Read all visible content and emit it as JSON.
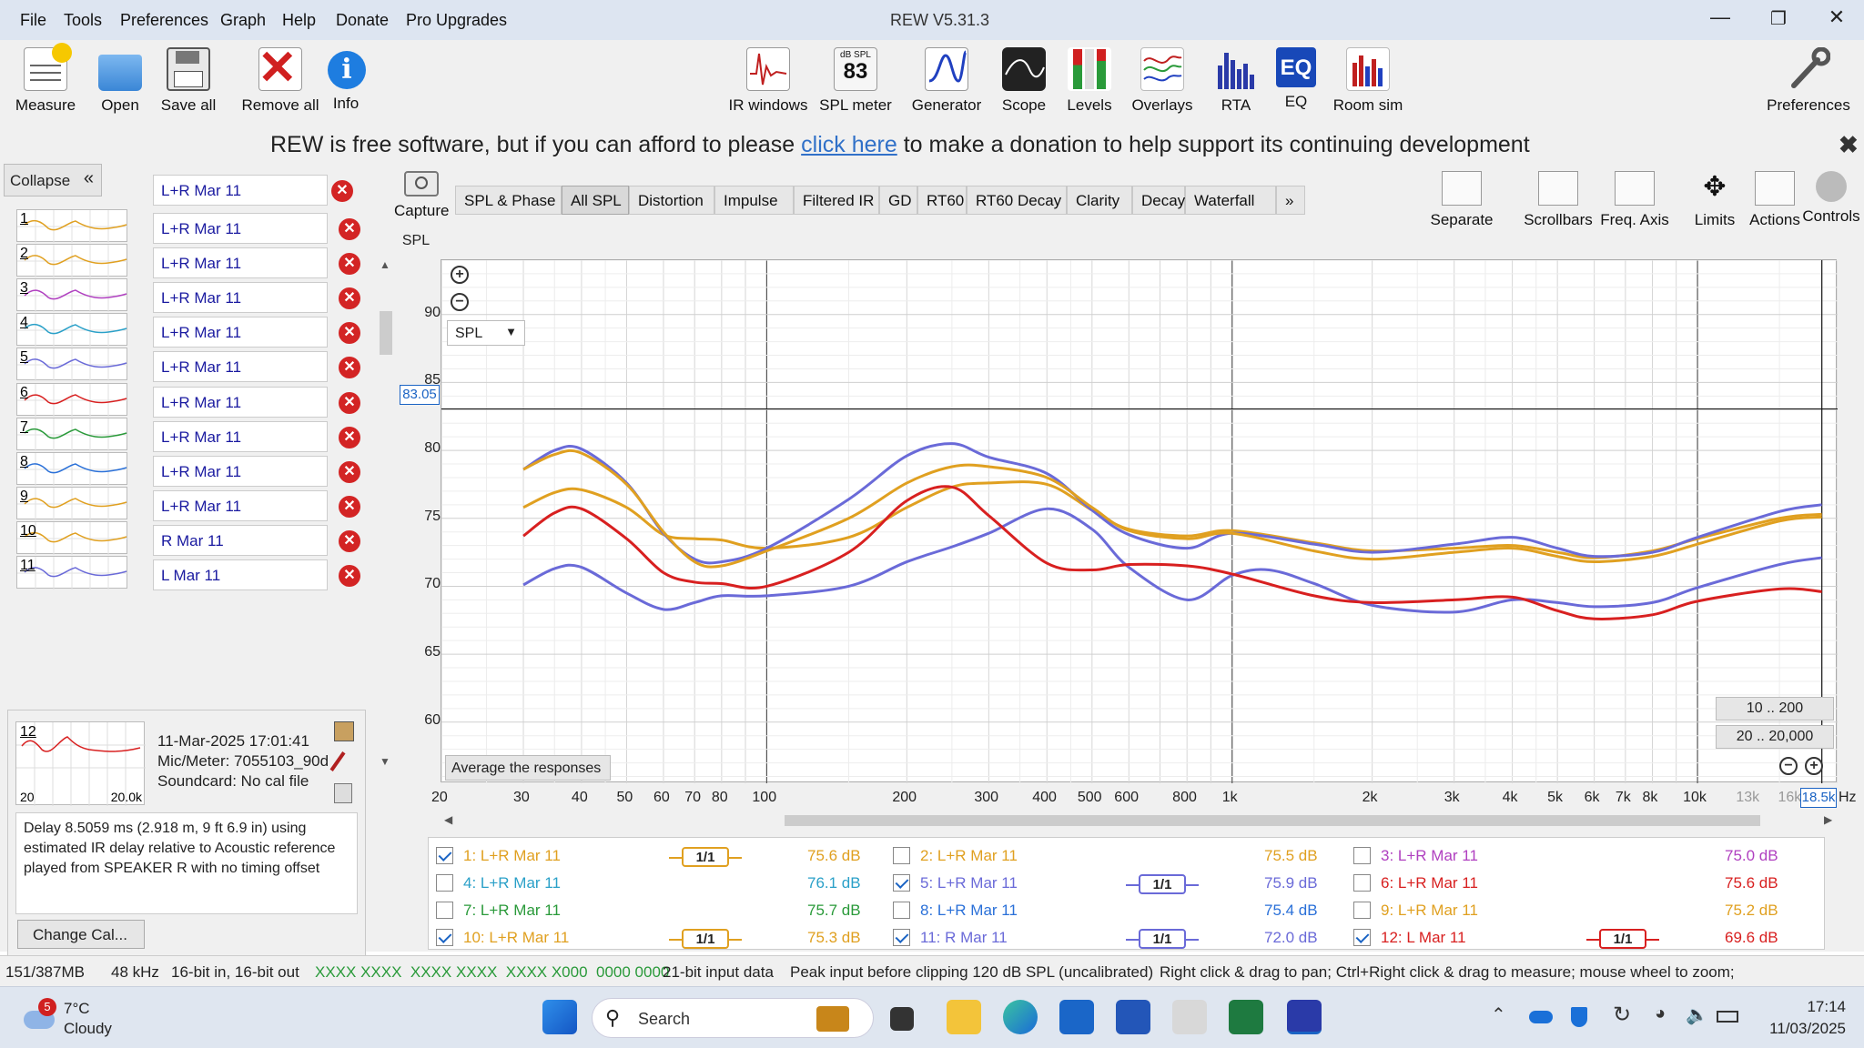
{
  "window": {
    "title": "REW V5.31.3"
  },
  "menu": [
    "File",
    "Tools",
    "Preferences",
    "Graph",
    "Help",
    "Donate",
    "Pro Upgrades"
  ],
  "toolbar_left": [
    {
      "label": "Measure",
      "icon": "measure-icon"
    },
    {
      "label": "Open",
      "icon": "folder-icon"
    },
    {
      "label": "Save all",
      "icon": "save-icon"
    },
    {
      "label": "Remove all",
      "icon": "remove-icon"
    },
    {
      "label": "Info",
      "icon": "info-icon"
    }
  ],
  "toolbar_center": [
    {
      "label": "IR windows",
      "icon": "ir-windows-icon"
    },
    {
      "label": "SPL meter",
      "icon": "spl-meter-icon",
      "badge_top": "dB SPL",
      "badge_value": "83"
    },
    {
      "label": "Generator",
      "icon": "generator-icon"
    },
    {
      "label": "Scope",
      "icon": "scope-icon"
    },
    {
      "label": "Levels",
      "icon": "levels-icon"
    },
    {
      "label": "Overlays",
      "icon": "overlays-icon"
    },
    {
      "label": "RTA",
      "icon": "rta-icon"
    },
    {
      "label": "EQ",
      "icon": "eq-icon"
    },
    {
      "label": "Room sim",
      "icon": "room-sim-icon"
    }
  ],
  "toolbar_right": {
    "label": "Preferences",
    "icon": "wrench-icon"
  },
  "donate": {
    "prefix": "REW is free software, but if you can afford to please ",
    "link": "click here",
    "suffix": " to make a donation to help support its continuing development"
  },
  "sidebar": {
    "collapse_label": "Collapse",
    "top_name": "L+R Mar 11",
    "measurements": [
      {
        "num": "1",
        "name": "L+R Mar 11",
        "color": "#e0a020"
      },
      {
        "num": "2",
        "name": "L+R Mar 11",
        "color": "#e0a020"
      },
      {
        "num": "3",
        "name": "L+R Mar 11",
        "color": "#b040c0"
      },
      {
        "num": "4",
        "name": "L+R Mar 11",
        "color": "#2aa0c8"
      },
      {
        "num": "5",
        "name": "L+R Mar 11",
        "color": "#6a6ad8"
      },
      {
        "num": "6",
        "name": "L+R Mar 11",
        "color": "#d82020"
      },
      {
        "num": "7",
        "name": "L+R Mar 11",
        "color": "#2a9a3a"
      },
      {
        "num": "8",
        "name": "L+R Mar 11",
        "color": "#2a70d8"
      },
      {
        "num": "9",
        "name": "L+R Mar 11",
        "color": "#e0a020"
      },
      {
        "num": "10",
        "name": "R Mar 11",
        "color": "#e0a020"
      },
      {
        "num": "11",
        "name": "L Mar 11",
        "color": "#6a6ad8"
      }
    ],
    "selected": {
      "num": "12",
      "date": "11-Mar-2025 17:01:41",
      "mic": "Mic/Meter: 7055103_90d",
      "soundcard": "Soundcard: No cal file",
      "axis_left": "20",
      "axis_right": "20.0k"
    },
    "delay_text": "Delay 8.5059 ms (2.918 m, 9 ft 6.9 in) using estimated IR delay relative to Acoustic reference played from SPEAKER R with no timing offset",
    "change_cal": "Change Cal..."
  },
  "graph": {
    "capture_label": "Capture",
    "tabs": [
      "SPL & Phase",
      "All SPL",
      "Distortion",
      "Impulse",
      "Filtered IR",
      "GD",
      "RT60",
      "RT60 Decay",
      "Clarity",
      "Decay",
      "Waterfall",
      "»"
    ],
    "active_tab": "All SPL",
    "right_tools": [
      "Separate",
      "Scrollbars",
      "Freq. Axis",
      "Limits",
      "Actions",
      "Controls"
    ],
    "y_title": "SPL",
    "y_ticks": [
      "90",
      "85",
      "80",
      "75",
      "70",
      "65",
      "60"
    ],
    "cursor_value": "83.05",
    "x_ticks": [
      "20",
      "30",
      "40",
      "50",
      "60",
      "70",
      "80",
      "100",
      "200",
      "300",
      "400",
      "500",
      "600",
      "800",
      "1k",
      "2k",
      "3k",
      "4k",
      "5k",
      "6k",
      "7k",
      "8k",
      "10k",
      "13k",
      "16k"
    ],
    "cursor_freq": "18.5k",
    "x_unit": "Hz",
    "dropdown": "SPL",
    "avg_button": "Average the responses",
    "range_buttons": [
      "10 .. 200",
      "20 .. 20,000"
    ]
  },
  "legend": [
    {
      "checked": true,
      "label": "1: L+R Mar 11",
      "color": "#e0a020",
      "smoothing": "1/1",
      "value": "75.6 dB"
    },
    {
      "checked": false,
      "label": "2: L+R Mar 11",
      "color": "#e0a020",
      "smoothing": "",
      "value": "75.5 dB"
    },
    {
      "checked": false,
      "label": "3: L+R Mar 11",
      "color": "#b040c0",
      "smoothing": "",
      "value": "75.0 dB"
    },
    {
      "checked": false,
      "label": "4: L+R Mar 11",
      "color": "#2aa0c8",
      "smoothing": "",
      "value": "76.1 dB"
    },
    {
      "checked": true,
      "label": "5: L+R Mar 11",
      "color": "#6a6ad8",
      "smoothing": "1/1",
      "value": "75.9 dB"
    },
    {
      "checked": false,
      "label": "6: L+R Mar 11",
      "color": "#d82020",
      "smoothing": "",
      "value": "75.6 dB"
    },
    {
      "checked": false,
      "label": "7: L+R Mar 11",
      "color": "#2a9a3a",
      "smoothing": "",
      "value": "75.7 dB"
    },
    {
      "checked": false,
      "label": "8: L+R Mar 11",
      "color": "#2a70d8",
      "smoothing": "",
      "value": "75.4 dB"
    },
    {
      "checked": false,
      "label": "9: L+R Mar 11",
      "color": "#e0a020",
      "smoothing": "",
      "value": "75.2 dB"
    },
    {
      "checked": true,
      "label": "10: L+R Mar 11",
      "color": "#e0a020",
      "smoothing": "1/1",
      "value": "75.3 dB"
    },
    {
      "checked": true,
      "label": "11: R Mar 11",
      "color": "#6a6ad8",
      "smoothing": "1/1",
      "value": "72.0 dB"
    },
    {
      "checked": true,
      "label": "12: L Mar 11",
      "color": "#d82020",
      "smoothing": "1/1",
      "value": "69.6 dB"
    }
  ],
  "status": {
    "memory": "151/387MB",
    "rate": "48 kHz",
    "bits": "16-bit in, 16-bit out",
    "levels": "XXXX XXXX  XXXX XXXX  XXXX X000  0000 0000",
    "input": "21-bit input data",
    "peak": "Peak input before clipping 120 dB SPL (uncalibrated)",
    "hint": "Right click & drag to pan; Ctrl+Right click & drag to measure; mouse wheel to zoom;"
  },
  "taskbar": {
    "weather_temp": "7°C",
    "weather_desc": "Cloudy",
    "weather_badge": "5",
    "search": "Search",
    "time": "17:14",
    "date": "11/03/2025"
  },
  "chart_data": {
    "type": "line",
    "x_scale": "log",
    "xlim": [
      20,
      20000
    ],
    "ylim": [
      55.5,
      94
    ],
    "ylabel": "SPL",
    "series": [
      {
        "name": "1: L+R Mar 11",
        "color": "#e0a020",
        "x": [
          30,
          35,
          40,
          50,
          60,
          70,
          80,
          100,
          150,
          200,
          250,
          300,
          400,
          500,
          600,
          800,
          1000,
          1500,
          2000,
          3000,
          4000,
          5000,
          6000,
          8000,
          10000,
          15000,
          18500
        ],
        "y": [
          75.8,
          76.9,
          77.1,
          75.8,
          73.8,
          73.5,
          73.4,
          72.8,
          73.6,
          75.8,
          77.3,
          77.6,
          77.5,
          75.6,
          74.2,
          73.7,
          74.1,
          73.2,
          72.6,
          72.8,
          73.0,
          72.5,
          72.1,
          72.6,
          73.5,
          75.0,
          75.3
        ]
      },
      {
        "name": "5: L+R Mar 11",
        "color": "#6a6ad8",
        "x": [
          30,
          35,
          40,
          50,
          60,
          70,
          80,
          100,
          150,
          200,
          250,
          300,
          400,
          500,
          600,
          800,
          1000,
          1500,
          2000,
          3000,
          4000,
          5000,
          6000,
          8000,
          10000,
          15000,
          18500
        ],
        "y": [
          78.6,
          80.0,
          80.1,
          77.6,
          73.9,
          72.0,
          71.8,
          72.8,
          76.4,
          79.6,
          80.5,
          79.5,
          78.3,
          75.6,
          73.8,
          72.8,
          73.9,
          73.1,
          72.5,
          73.1,
          73.6,
          72.8,
          72.2,
          72.5,
          73.6,
          75.5,
          76.0
        ]
      },
      {
        "name": "10: L+R Mar 11",
        "color": "#e0a020",
        "x": [
          30,
          35,
          40,
          50,
          60,
          70,
          80,
          100,
          150,
          200,
          250,
          300,
          400,
          500,
          600,
          800,
          1000,
          1500,
          2000,
          3000,
          4000,
          5000,
          6000,
          8000,
          10000,
          15000,
          18500
        ],
        "y": [
          78.6,
          79.7,
          79.8,
          77.5,
          74.0,
          71.8,
          71.5,
          72.6,
          75.0,
          77.6,
          78.8,
          78.8,
          78.0,
          75.8,
          74.1,
          73.5,
          73.9,
          72.6,
          72.0,
          72.5,
          72.8,
          72.2,
          71.8,
          72.2,
          73.1,
          74.8,
          75.1
        ]
      },
      {
        "name": "11: R Mar 11",
        "color": "#6a6ad8",
        "x": [
          30,
          35,
          40,
          50,
          60,
          70,
          80,
          100,
          150,
          200,
          250,
          300,
          400,
          500,
          600,
          800,
          1000,
          1200,
          1500,
          2000,
          3000,
          4000,
          5000,
          6000,
          8000,
          10000,
          15000,
          18500
        ],
        "y": [
          70.1,
          71.3,
          71.4,
          69.5,
          68.3,
          68.8,
          69.3,
          69.3,
          70.0,
          71.8,
          72.9,
          73.9,
          75.7,
          74.2,
          71.4,
          69.0,
          70.8,
          71.2,
          70.2,
          68.6,
          68.1,
          69.0,
          68.8,
          68.5,
          68.8,
          69.9,
          71.6,
          72.1
        ]
      },
      {
        "name": "12: L Mar 11",
        "color": "#d82020",
        "x": [
          30,
          35,
          40,
          50,
          60,
          70,
          80,
          100,
          150,
          200,
          250,
          300,
          400,
          500,
          600,
          800,
          1000,
          1500,
          2000,
          3000,
          4000,
          5000,
          6000,
          8000,
          10000,
          15000,
          18500
        ],
        "y": [
          73.7,
          75.4,
          75.7,
          73.5,
          71.0,
          70.3,
          70.2,
          70.0,
          72.5,
          76.3,
          77.3,
          75.2,
          71.7,
          71.2,
          71.6,
          71.5,
          70.9,
          69.3,
          68.8,
          69.0,
          69.2,
          68.2,
          67.6,
          67.9,
          68.9,
          69.8,
          69.6
        ]
      }
    ]
  }
}
